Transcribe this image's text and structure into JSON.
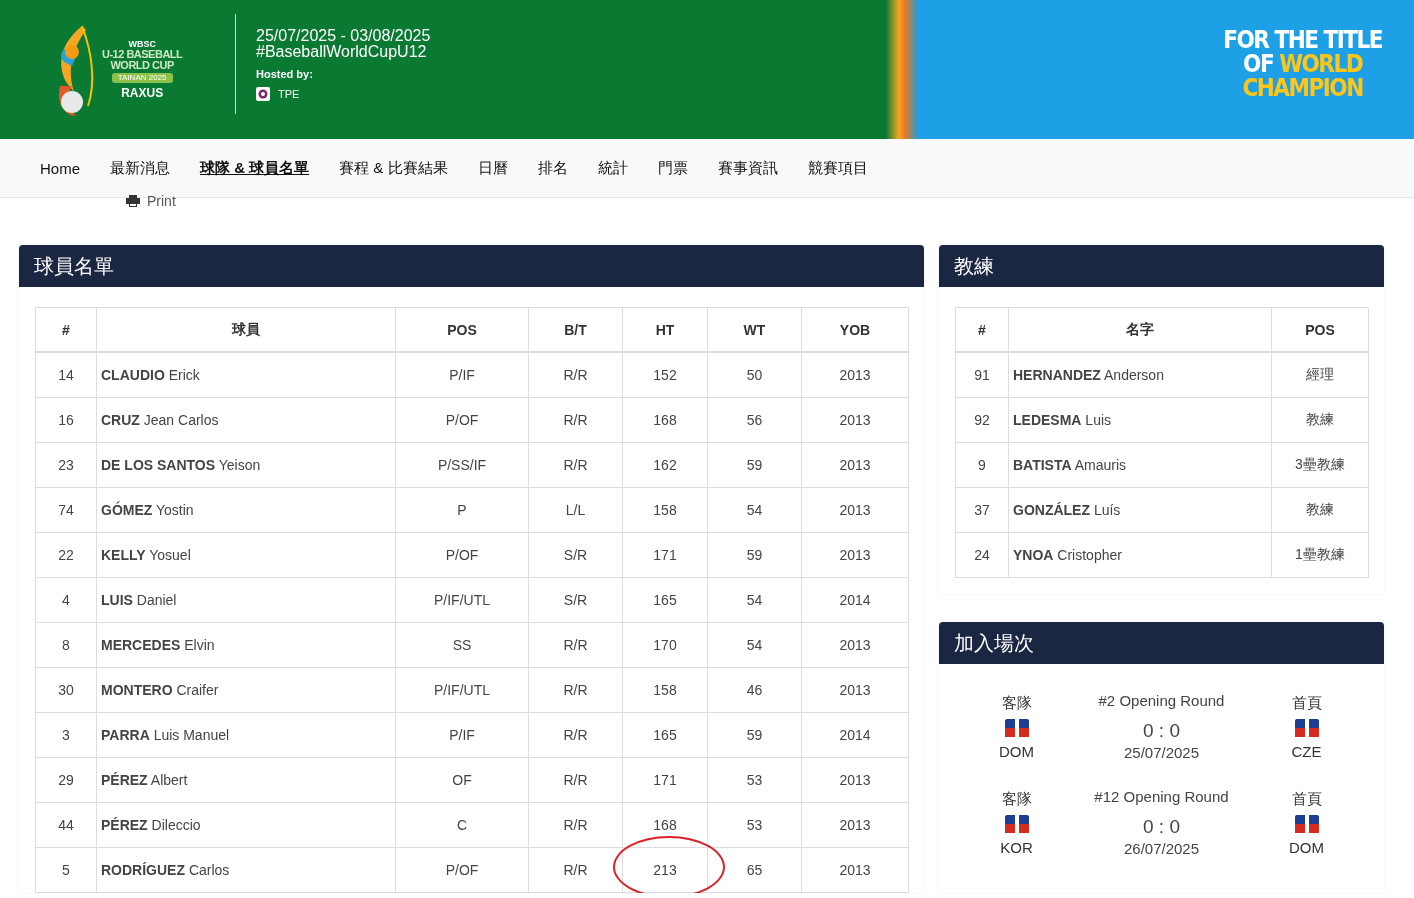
{
  "header": {
    "logo": {
      "org": "WBSC",
      "line1": "U-12 BASEBALL",
      "line2": "WORLD CUP",
      "edition": "TAINAN 2025",
      "sponsor": "RAXUS"
    },
    "dates": "25/07/2025 - 03/08/2025",
    "hashtag": "#BaseballWorldCupU12",
    "hosted_label": "Hosted by:",
    "host": "TPE",
    "slogan": {
      "line1": "FOR THE TITLE",
      "line2_white": "OF",
      "line2_gold": "WORLD",
      "line3": "CHAMPION"
    }
  },
  "nav": [
    {
      "label": "Home",
      "selected": false
    },
    {
      "label": "最新消息",
      "selected": false
    },
    {
      "label": "球隊 & 球員名單",
      "selected": true
    },
    {
      "label": "賽程 & 比賽結果",
      "selected": false
    },
    {
      "label": "日曆",
      "selected": false
    },
    {
      "label": "排名",
      "selected": false
    },
    {
      "label": "統計",
      "selected": false
    },
    {
      "label": "門票",
      "selected": false
    },
    {
      "label": "賽事資訊",
      "selected": false
    },
    {
      "label": "競賽項目",
      "selected": false
    }
  ],
  "print": "Print",
  "roster": {
    "title": "球員名單",
    "columns": [
      "#",
      "球員",
      "POS",
      "B/T",
      "HT",
      "WT",
      "YOB"
    ],
    "rows": [
      {
        "num": "14",
        "name": "**CLAUDIO** Erick",
        "pos": "P/IF",
        "bt": "R/R",
        "ht": "152",
        "wt": "50",
        "yob": "2013",
        "ht_circled": false
      },
      {
        "num": "16",
        "name": "**CRUZ** Jean Carlos",
        "pos": "P/OF",
        "bt": "R/R",
        "ht": "168",
        "wt": "56",
        "yob": "2013",
        "ht_circled": false
      },
      {
        "num": "23",
        "name": "**DE LOS SANTOS** Yeison",
        "pos": "P/SS/IF",
        "bt": "R/R",
        "ht": "162",
        "wt": "59",
        "yob": "2013",
        "ht_circled": false
      },
      {
        "num": "74",
        "name": "**GÓMEZ** Yostin",
        "pos": "P",
        "bt": "L/L",
        "ht": "158",
        "wt": "54",
        "yob": "2013",
        "ht_circled": false
      },
      {
        "num": "22",
        "name": "**KELLY** Yosuel",
        "pos": "P/OF",
        "bt": "S/R",
        "ht": "171",
        "wt": "59",
        "yob": "2013",
        "ht_circled": false
      },
      {
        "num": "4",
        "name": "**LUIS** Daniel",
        "pos": "P/IF/UTL",
        "bt": "S/R",
        "ht": "165",
        "wt": "54",
        "yob": "2014",
        "ht_circled": false
      },
      {
        "num": "8",
        "name": "**MERCEDES** Elvin",
        "pos": "SS",
        "bt": "R/R",
        "ht": "170",
        "wt": "54",
        "yob": "2013",
        "ht_circled": false
      },
      {
        "num": "30",
        "name": "**MONTERO** Craifer",
        "pos": "P/IF/UTL",
        "bt": "R/R",
        "ht": "158",
        "wt": "46",
        "yob": "2013",
        "ht_circled": false
      },
      {
        "num": "3",
        "name": "**PARRA** Luis Manuel",
        "pos": "P/IF",
        "bt": "R/R",
        "ht": "165",
        "wt": "59",
        "yob": "2014",
        "ht_circled": false
      },
      {
        "num": "29",
        "name": "**PÉREZ** Albert",
        "pos": "OF",
        "bt": "R/R",
        "ht": "171",
        "wt": "53",
        "yob": "2013",
        "ht_circled": false
      },
      {
        "num": "44",
        "name": "**PÉREZ** Dileccio",
        "pos": "C",
        "bt": "R/R",
        "ht": "168",
        "wt": "53",
        "yob": "2013",
        "ht_circled": false
      },
      {
        "num": "5",
        "name": "**RODRÍGUEZ** Carlos",
        "pos": "P/OF",
        "bt": "R/R",
        "ht": "213",
        "wt": "65",
        "yob": "2013",
        "ht_circled": true
      }
    ]
  },
  "coaches": {
    "title": "教練",
    "columns": [
      "#",
      "名字",
      "POS"
    ],
    "rows": [
      {
        "num": "91",
        "name": "**HERNANDEZ** Anderson",
        "pos": "經理"
      },
      {
        "num": "92",
        "name": "**LEDESMA** Luis",
        "pos": "教練"
      },
      {
        "num": "9",
        "name": "**BATISTA** Amauris",
        "pos": "3壘教練"
      },
      {
        "num": "37",
        "name": "**GONZÁLEZ** Luís",
        "pos": "教練"
      },
      {
        "num": "24",
        "name": "**YNOA** Cristopher",
        "pos": "1壘教練"
      }
    ]
  },
  "games": {
    "title": "加入場次",
    "items": [
      {
        "away_label": "客隊",
        "away": "DOM",
        "round": "#2 Opening Round",
        "score": "0 : 0",
        "date": "25/07/2025",
        "home_label": "首頁",
        "home": "CZE"
      },
      {
        "away_label": "客隊",
        "away": "KOR",
        "round": "#12 Opening Round",
        "score": "0 : 0",
        "date": "26/07/2025",
        "home_label": "首頁",
        "home": "DOM"
      }
    ]
  }
}
